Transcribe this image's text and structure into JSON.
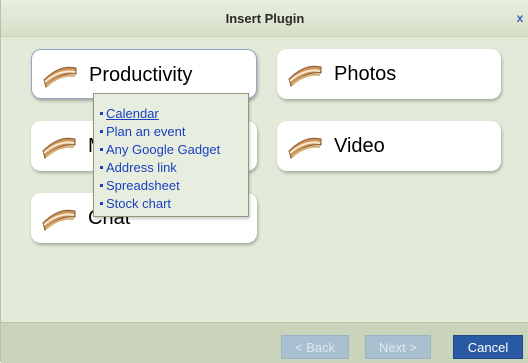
{
  "dialog": {
    "title": "Insert Plugin",
    "close_label": "x"
  },
  "categories": [
    {
      "label": "Productivity",
      "icon": "sandwich-icon"
    },
    {
      "label": "Photos",
      "icon": "sandwich-icon"
    },
    {
      "label": "M",
      "icon": "sandwich-icon"
    },
    {
      "label": "Video",
      "icon": "sandwich-icon"
    },
    {
      "label": "Chat",
      "icon": "sandwich-icon"
    }
  ],
  "popup": {
    "items": [
      "Calendar",
      "Plan an event",
      "Any Google Gadget",
      "Address link",
      "Spreadsheet",
      "Stock chart"
    ]
  },
  "footer": {
    "back_label": "< Back",
    "next_label": "Next >",
    "cancel_label": "Cancel"
  },
  "colors": {
    "accent": "#2a5aa4",
    "link": "#1a3fc0",
    "panel": "#e3ead9"
  }
}
